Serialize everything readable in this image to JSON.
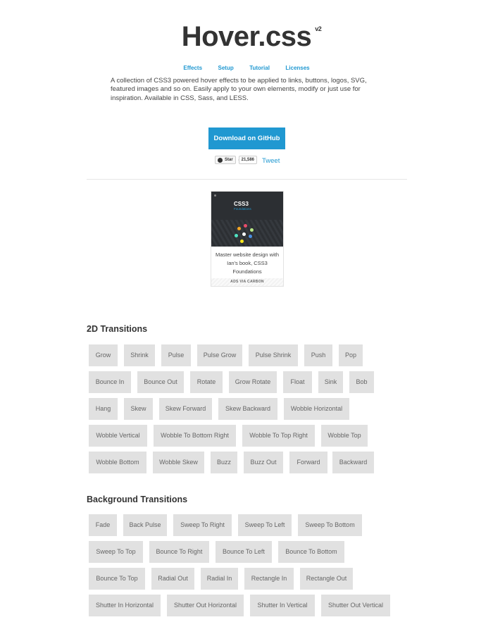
{
  "header": {
    "title": "Hover.css",
    "version": "v2",
    "nav": [
      "Effects",
      "Setup",
      "Tutorial",
      "Licenses"
    ],
    "description": "A collection of CSS3 powered hover effects to be applied to links, buttons, logos, SVG, featured images and so on. Easily apply to your own elements, modify or just use for inspiration. Available in CSS, Sass, and LESS.",
    "download_label": "Download on GitHub",
    "star_label": "Star",
    "star_count": "21,586",
    "tweet_label": "Tweet"
  },
  "ad": {
    "image_title": "CSS3",
    "image_subtitle": "Foundations",
    "text": "Master website design with Ian's book, CSS3 Foundations",
    "footer": "ADS VIA CARBON"
  },
  "sections": [
    {
      "title": "2D Transitions",
      "buttons": [
        "Grow",
        "Shrink",
        "Pulse",
        "Pulse Grow",
        "Pulse Shrink",
        "Push",
        "Pop",
        "Bounce In",
        "Bounce Out",
        "Rotate",
        "Grow Rotate",
        "Float",
        "Sink",
        "Bob",
        "Hang",
        "Skew",
        "Skew Forward",
        "Skew Backward",
        "Wobble Horizontal",
        "Wobble Vertical",
        "Wobble To Bottom Right",
        "Wobble To Top Right",
        "Wobble Top",
        "Wobble Bottom",
        "Wobble Skew",
        "Buzz",
        "Buzz Out",
        "Forward",
        "Backward"
      ]
    },
    {
      "title": "Background Transitions",
      "buttons": [
        "Fade",
        "Back Pulse",
        "Sweep To Right",
        "Sweep To Left",
        "Sweep To Bottom",
        "Sweep To Top",
        "Bounce To Right",
        "Bounce To Left",
        "Bounce To Bottom",
        "Bounce To Top",
        "Radial Out",
        "Radial In",
        "Rectangle In",
        "Rectangle Out",
        "Shutter In Horizontal",
        "Shutter Out Horizontal",
        "Shutter In Vertical",
        "Shutter Out Vertical"
      ]
    }
  ],
  "colors": {
    "accent": "#2098d1",
    "button_bg": "#e1e1e1",
    "button_text": "#666666"
  }
}
